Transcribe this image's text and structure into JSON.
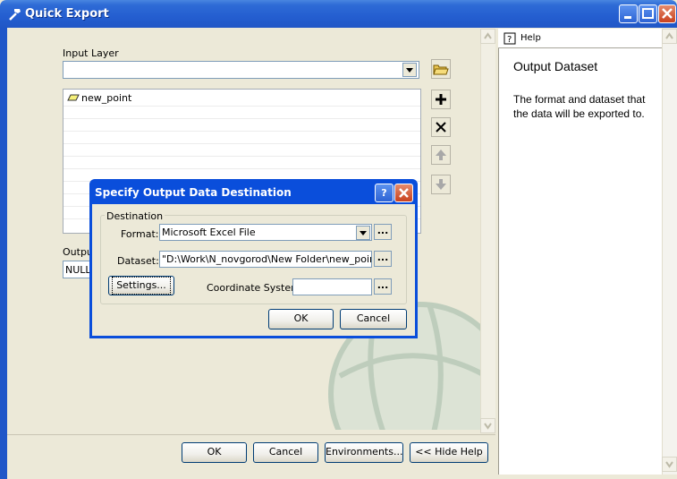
{
  "window": {
    "title": "Quick Export",
    "minimize_icon": "minimize-icon",
    "maximize_icon": "maximize-icon",
    "close_icon": "close-icon"
  },
  "form": {
    "input_layer_label": "Input Layer",
    "input_layer_value": "",
    "list_items": [
      {
        "label": "new_point",
        "icon": "polygon-layer-icon"
      }
    ],
    "output_label_partial": "Outpu",
    "output_value_partial": "NULL"
  },
  "side_tools": [
    "add-icon",
    "remove-icon",
    "move-up-icon",
    "move-down-icon"
  ],
  "buttons": {
    "ok": "OK",
    "cancel": "Cancel",
    "environments": "Environments...",
    "hide_help": "<< Hide Help"
  },
  "help": {
    "header": "Help",
    "title": "Output Dataset",
    "body": "The format and dataset that the data will be exported to."
  },
  "dialog": {
    "title": "Specify Output Data Destination",
    "group_label": "Destination",
    "format_label": "Format:",
    "format_value": "Microsoft Excel File",
    "dataset_label": "Dataset:",
    "dataset_value": "\"D:\\Work\\N_novgorod\\New Folder\\new_point.xl",
    "settings_button": "Settings...",
    "coord_label": "Coordinate System:",
    "coord_value": "",
    "browse": "...",
    "ok": "OK",
    "cancel": "Cancel"
  },
  "colors": {
    "title_bar": "#245ED0",
    "dialog_frame": "#0A4EDB",
    "window_bg": "#ECE9D8"
  }
}
